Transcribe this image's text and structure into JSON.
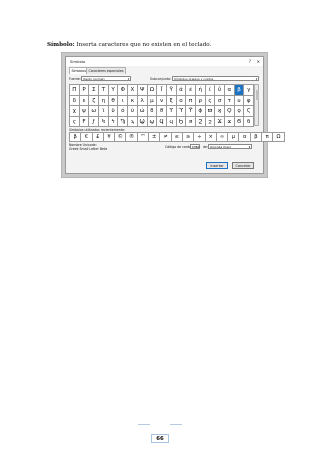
{
  "document": {
    "heading": "Símbolo:",
    "text": " Inserta caracteres que no existen en el teclado."
  },
  "dialog": {
    "title": "Símbolo",
    "help": "?",
    "close": "✕",
    "tabs": [
      "Símbolos",
      "Caracteres especiales"
    ],
    "font_label": "Fuente:",
    "font_value": "(texto normal)",
    "subset_label": "Subconjunto:",
    "subset_value": "Símbolos griegos y coptos",
    "grid": [
      [
        "Π",
        "Ρ",
        "Σ",
        "Τ",
        "Υ",
        "Φ",
        "Χ",
        "Ψ",
        "Ω",
        "Ϊ",
        "Ϋ",
        "ά",
        "έ",
        "ή",
        "ί",
        "ΰ",
        "α",
        "β",
        "γ"
      ],
      [
        "δ",
        "ε",
        "ζ",
        "η",
        "θ",
        "ι",
        "κ",
        "λ",
        "μ",
        "ν",
        "ξ",
        "ο",
        "π",
        "ρ",
        "ς",
        "σ",
        "τ",
        "υ",
        "φ"
      ],
      [
        "χ",
        "ψ",
        "ω",
        "ϊ",
        "ϋ",
        "ό",
        "ύ",
        "ώ",
        "ϐ",
        "ϑ",
        "ϒ",
        "ϓ",
        "ϔ",
        "ϕ",
        "ϖ",
        "ϗ",
        "Ϙ",
        "ϙ",
        "Ϛ"
      ],
      [
        "ϛ",
        "Ϝ",
        "ϝ",
        "Ϟ",
        "ϟ",
        "Ϡ",
        "ϡ",
        "Ϣ",
        "ϣ",
        "Ϥ",
        "ϥ",
        "Ϧ",
        "ϧ",
        "Ϩ",
        "ϩ",
        "Ϫ",
        "ϫ",
        "Ϭ",
        "ϭ"
      ]
    ],
    "selected_row": 0,
    "selected_col": 17,
    "recent_label": "Símbolos utilizados recientemente:",
    "recent": [
      "β",
      "€",
      "£",
      "¥",
      "©",
      "®",
      "™",
      "±",
      "≠",
      "≤",
      "≥",
      "÷",
      "×",
      "∞",
      "µ",
      "α",
      "β",
      "π",
      "Ω"
    ],
    "unicode_name_label": "Nombre Unicode:",
    "unicode_name_value": "Greek Small Letter Beta",
    "code_label": "Código de carácter:",
    "code_value": "03B2",
    "from_label": "de:",
    "from_value": "Unicode (hex)",
    "insert_button": "Insertar",
    "cancel_button": "Cancelar"
  },
  "page_number": "66"
}
